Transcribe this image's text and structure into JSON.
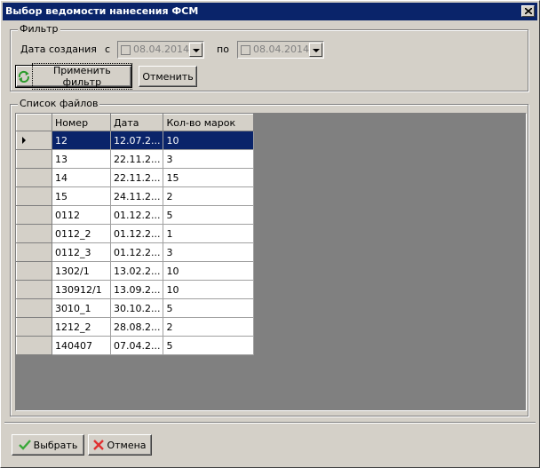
{
  "window": {
    "title": "Выбор ведомости нанесения ФСМ"
  },
  "filter": {
    "legend": "Фильтр",
    "created_label": "Дата создания",
    "from_label": "с",
    "from_date": "08.04.2014",
    "to_label": "по",
    "to_date": "08.04.2014",
    "apply_label": "Применить фильтр",
    "cancel_label": "Отменить"
  },
  "files": {
    "legend": "Список файлов",
    "columns": [
      "Номер",
      "Дата",
      "Кол-во марок"
    ],
    "selected_index": 0,
    "rows": [
      [
        "12",
        "12.07.2...",
        "10"
      ],
      [
        "13",
        "22.11.2...",
        "3"
      ],
      [
        "14",
        "22.11.2...",
        "15"
      ],
      [
        "15",
        "24.11.2...",
        "2"
      ],
      [
        "0112",
        "01.12.2...",
        "5"
      ],
      [
        "0112_2",
        "01.12.2...",
        "1"
      ],
      [
        "0112_3",
        "01.12.2...",
        "3"
      ],
      [
        "1302/1",
        "13.02.2...",
        "10"
      ],
      [
        "130912/1",
        "13.09.2...",
        "10"
      ],
      [
        "3010_1",
        "30.10.2...",
        "5"
      ],
      [
        "1212_2",
        "28.08.2...",
        "2"
      ],
      [
        "140407",
        "07.04.2...",
        "5"
      ]
    ]
  },
  "footer": {
    "select_label": "Выбрать",
    "cancel_label": "Отмена"
  },
  "colors": {
    "title_bg": "#0a246a",
    "face": "#d4d0c8",
    "grid_bg": "#808080",
    "selection": "#0a246a"
  }
}
